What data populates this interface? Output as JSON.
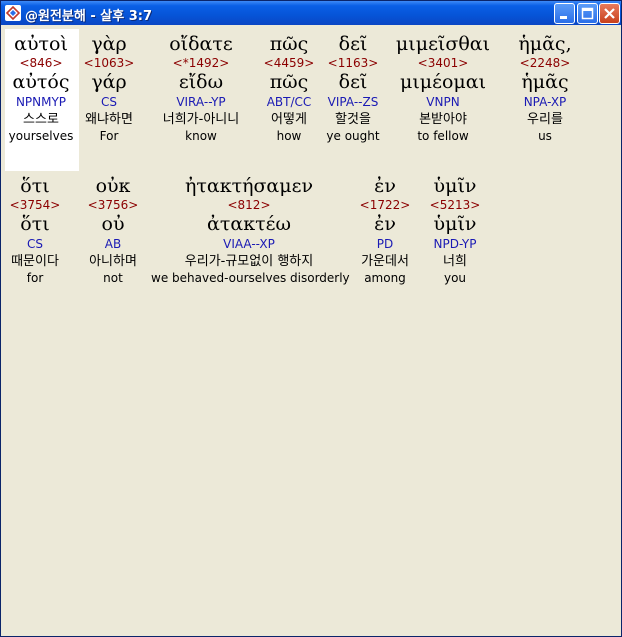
{
  "window": {
    "title": "@원전분해 - 살후 3:7",
    "minimize_label": "minimize",
    "maximize_label": "maximize",
    "close_label": "close"
  },
  "lines": [
    [
      {
        "greek": "αὐτοὶ",
        "strongs": "<846>",
        "lexeme": "αὐτός",
        "parsing": "NPNMYP",
        "korean": "스스로",
        "english": "yourselves"
      },
      {
        "greek": "γὰρ",
        "strongs": "<1063>",
        "lexeme": "γάρ",
        "parsing": "CS",
        "korean": "왜냐하면",
        "english": "For"
      },
      {
        "greek": "οἴδατε",
        "strongs": "<*1492>",
        "lexeme": "εἴδω",
        "parsing": "VIRA--YP",
        "korean": "너희가-아니니",
        "english": "know"
      },
      {
        "greek": "πῶς",
        "strongs": "<4459>",
        "lexeme": "πῶς",
        "parsing": "ABT/CC",
        "korean": "어떻게",
        "english": "how"
      },
      {
        "greek": "δεῖ",
        "strongs": "<1163>",
        "lexeme": "δεῖ",
        "parsing": "VIPA--ZS",
        "korean": "할것을",
        "english": "ye ought"
      },
      {
        "greek": "μιμεῖσθαι",
        "strongs": "<3401>",
        "lexeme": "μιμέομαι",
        "parsing": "VNPN",
        "korean": "본받아야",
        "english": "to fellow"
      },
      {
        "greek": "ἡμᾶς,",
        "strongs": "<2248>",
        "lexeme": "ἡμᾶς",
        "parsing": "NPA-XP",
        "korean": "우리를",
        "english": "us"
      }
    ],
    [
      {
        "greek": "ὅτι",
        "strongs": "<3754>",
        "lexeme": "ὅτι",
        "parsing": "CS",
        "korean": "때문이다",
        "english": "for"
      },
      {
        "greek": "οὐκ",
        "strongs": "<3756>",
        "lexeme": "οὐ",
        "parsing": "AB",
        "korean": "아니하며",
        "english": "not"
      },
      {
        "greek": "ἠτακτήσαμεν",
        "strongs": "<812>",
        "lexeme": "ἀτακτέω",
        "parsing": "VIAA--XP",
        "korean": "우리가-규모없이 행하지",
        "english": "we behaved-ourselves disorderly"
      },
      {
        "greek": "ἐν",
        "strongs": "<1722>",
        "lexeme": "ἐν",
        "parsing": "PD",
        "korean": "가운데서",
        "english": "among"
      },
      {
        "greek": "ὑμῖν",
        "strongs": "<5213>",
        "lexeme": "ὑμῖν",
        "parsing": "NPD-YP",
        "korean": "너희",
        "english": "you"
      }
    ]
  ]
}
